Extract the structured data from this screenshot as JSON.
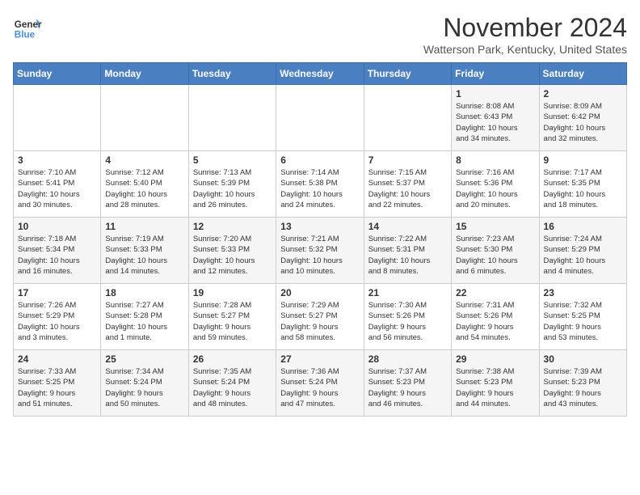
{
  "logo": {
    "line1": "General",
    "line2": "Blue"
  },
  "title": "November 2024",
  "location": "Watterson Park, Kentucky, United States",
  "days_of_week": [
    "Sunday",
    "Monday",
    "Tuesday",
    "Wednesday",
    "Thursday",
    "Friday",
    "Saturday"
  ],
  "weeks": [
    [
      {
        "day": "",
        "info": ""
      },
      {
        "day": "",
        "info": ""
      },
      {
        "day": "",
        "info": ""
      },
      {
        "day": "",
        "info": ""
      },
      {
        "day": "",
        "info": ""
      },
      {
        "day": "1",
        "info": "Sunrise: 8:08 AM\nSunset: 6:43 PM\nDaylight: 10 hours\nand 34 minutes."
      },
      {
        "day": "2",
        "info": "Sunrise: 8:09 AM\nSunset: 6:42 PM\nDaylight: 10 hours\nand 32 minutes."
      }
    ],
    [
      {
        "day": "3",
        "info": "Sunrise: 7:10 AM\nSunset: 5:41 PM\nDaylight: 10 hours\nand 30 minutes."
      },
      {
        "day": "4",
        "info": "Sunrise: 7:12 AM\nSunset: 5:40 PM\nDaylight: 10 hours\nand 28 minutes."
      },
      {
        "day": "5",
        "info": "Sunrise: 7:13 AM\nSunset: 5:39 PM\nDaylight: 10 hours\nand 26 minutes."
      },
      {
        "day": "6",
        "info": "Sunrise: 7:14 AM\nSunset: 5:38 PM\nDaylight: 10 hours\nand 24 minutes."
      },
      {
        "day": "7",
        "info": "Sunrise: 7:15 AM\nSunset: 5:37 PM\nDaylight: 10 hours\nand 22 minutes."
      },
      {
        "day": "8",
        "info": "Sunrise: 7:16 AM\nSunset: 5:36 PM\nDaylight: 10 hours\nand 20 minutes."
      },
      {
        "day": "9",
        "info": "Sunrise: 7:17 AM\nSunset: 5:35 PM\nDaylight: 10 hours\nand 18 minutes."
      }
    ],
    [
      {
        "day": "10",
        "info": "Sunrise: 7:18 AM\nSunset: 5:34 PM\nDaylight: 10 hours\nand 16 minutes."
      },
      {
        "day": "11",
        "info": "Sunrise: 7:19 AM\nSunset: 5:33 PM\nDaylight: 10 hours\nand 14 minutes."
      },
      {
        "day": "12",
        "info": "Sunrise: 7:20 AM\nSunset: 5:33 PM\nDaylight: 10 hours\nand 12 minutes."
      },
      {
        "day": "13",
        "info": "Sunrise: 7:21 AM\nSunset: 5:32 PM\nDaylight: 10 hours\nand 10 minutes."
      },
      {
        "day": "14",
        "info": "Sunrise: 7:22 AM\nSunset: 5:31 PM\nDaylight: 10 hours\nand 8 minutes."
      },
      {
        "day": "15",
        "info": "Sunrise: 7:23 AM\nSunset: 5:30 PM\nDaylight: 10 hours\nand 6 minutes."
      },
      {
        "day": "16",
        "info": "Sunrise: 7:24 AM\nSunset: 5:29 PM\nDaylight: 10 hours\nand 4 minutes."
      }
    ],
    [
      {
        "day": "17",
        "info": "Sunrise: 7:26 AM\nSunset: 5:29 PM\nDaylight: 10 hours\nand 3 minutes."
      },
      {
        "day": "18",
        "info": "Sunrise: 7:27 AM\nSunset: 5:28 PM\nDaylight: 10 hours\nand 1 minute."
      },
      {
        "day": "19",
        "info": "Sunrise: 7:28 AM\nSunset: 5:27 PM\nDaylight: 9 hours\nand 59 minutes."
      },
      {
        "day": "20",
        "info": "Sunrise: 7:29 AM\nSunset: 5:27 PM\nDaylight: 9 hours\nand 58 minutes."
      },
      {
        "day": "21",
        "info": "Sunrise: 7:30 AM\nSunset: 5:26 PM\nDaylight: 9 hours\nand 56 minutes."
      },
      {
        "day": "22",
        "info": "Sunrise: 7:31 AM\nSunset: 5:26 PM\nDaylight: 9 hours\nand 54 minutes."
      },
      {
        "day": "23",
        "info": "Sunrise: 7:32 AM\nSunset: 5:25 PM\nDaylight: 9 hours\nand 53 minutes."
      }
    ],
    [
      {
        "day": "24",
        "info": "Sunrise: 7:33 AM\nSunset: 5:25 PM\nDaylight: 9 hours\nand 51 minutes."
      },
      {
        "day": "25",
        "info": "Sunrise: 7:34 AM\nSunset: 5:24 PM\nDaylight: 9 hours\nand 50 minutes."
      },
      {
        "day": "26",
        "info": "Sunrise: 7:35 AM\nSunset: 5:24 PM\nDaylight: 9 hours\nand 48 minutes."
      },
      {
        "day": "27",
        "info": "Sunrise: 7:36 AM\nSunset: 5:24 PM\nDaylight: 9 hours\nand 47 minutes."
      },
      {
        "day": "28",
        "info": "Sunrise: 7:37 AM\nSunset: 5:23 PM\nDaylight: 9 hours\nand 46 minutes."
      },
      {
        "day": "29",
        "info": "Sunrise: 7:38 AM\nSunset: 5:23 PM\nDaylight: 9 hours\nand 44 minutes."
      },
      {
        "day": "30",
        "info": "Sunrise: 7:39 AM\nSunset: 5:23 PM\nDaylight: 9 hours\nand 43 minutes."
      }
    ]
  ]
}
